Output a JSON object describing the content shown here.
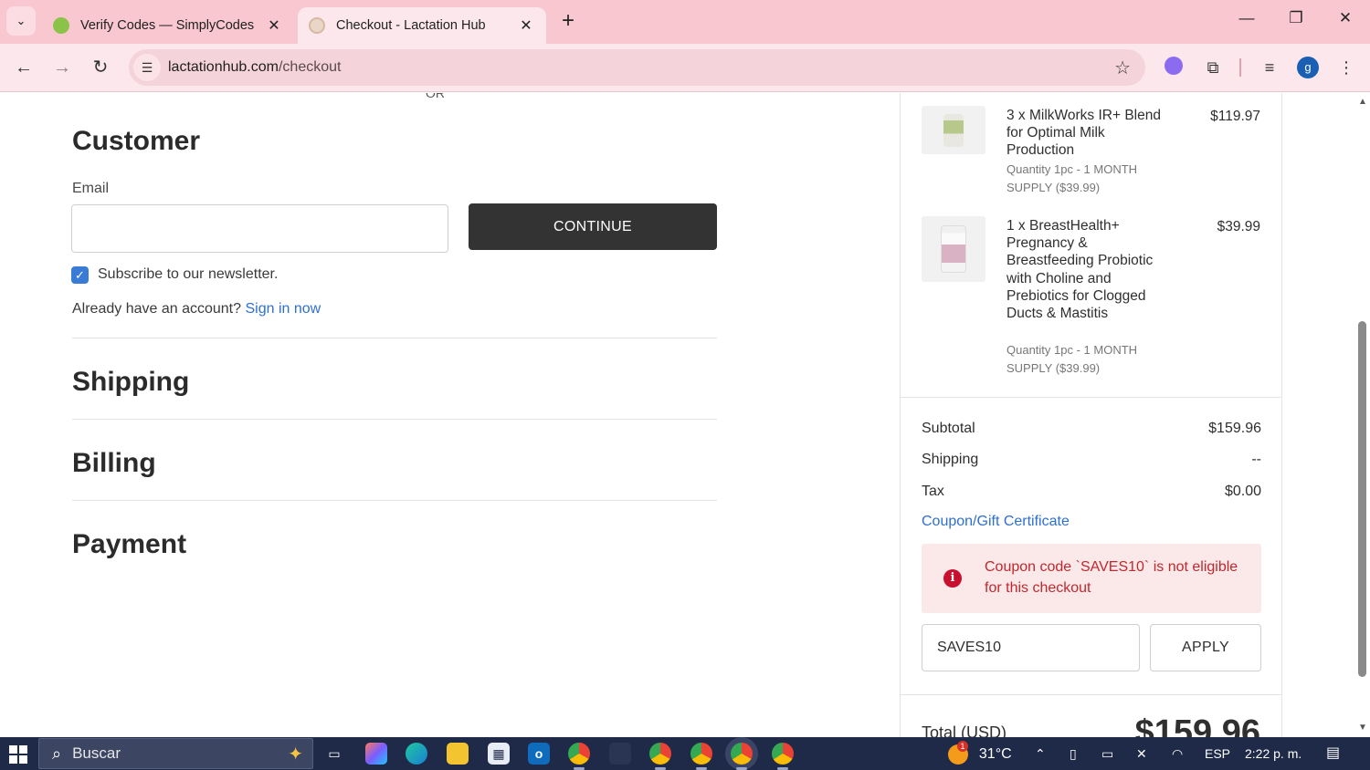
{
  "browser": {
    "tabs": [
      {
        "title": "Verify Codes — SimplyCodes",
        "active": false
      },
      {
        "title": "Checkout - Lactation Hub",
        "active": true
      }
    ],
    "url_domain": "lactationhub.com",
    "url_path": "/checkout"
  },
  "checkout": {
    "or_divider": "OR",
    "customer_heading": "Customer",
    "email_label": "Email",
    "email_value": "",
    "continue_label": "CONTINUE",
    "newsletter_label": "Subscribe to our newsletter.",
    "newsletter_checked": true,
    "account_prompt": "Already have an account?",
    "signin_link": "Sign in now",
    "shipping_heading": "Shipping",
    "billing_heading": "Billing",
    "payment_heading": "Payment"
  },
  "summary": {
    "items": [
      {
        "name": "3 x MilkWorks IR+ Blend for Optimal Milk Production",
        "meta": "Quantity 1pc - 1 MONTH SUPPLY ($39.99)",
        "price": "$119.97"
      },
      {
        "name": "1 x BreastHealth+ Pregnancy & Breastfeeding Probiotic with Choline and Prebiotics for Clogged Ducts & Mastitis",
        "meta": "Quantity 1pc - 1 MONTH SUPPLY ($39.99)",
        "price": "$39.99"
      }
    ],
    "subtotal_label": "Subtotal",
    "subtotal_value": "$159.96",
    "shipping_label": "Shipping",
    "shipping_value": "--",
    "tax_label": "Tax",
    "tax_value": "$0.00",
    "coupon_link": "Coupon/Gift Certificate",
    "coupon_error": "Coupon code `SAVES10` is not eligible for this checkout",
    "coupon_value": "SAVES10",
    "apply_label": "APPLY",
    "total_label": "Total (USD)",
    "total_value": "$159.96"
  },
  "taskbar": {
    "search_placeholder": "Buscar",
    "weather": "31°C",
    "weather_badge": "1",
    "language": "ESP",
    "time": "2:22 p. m."
  },
  "colors": {
    "tab_strip": "#f8c7d0",
    "toolbar": "#fce8ec",
    "primary_button": "#333333",
    "link": "#2e6fd0",
    "error_bg": "#fbe9ea",
    "error_text": "#c0282d",
    "taskbar": "#1f2a48"
  }
}
